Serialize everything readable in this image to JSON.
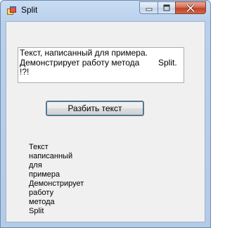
{
  "window": {
    "title": "Split"
  },
  "input": {
    "lines": [
      "Текст, написанный для примера.",
      "Демонстрирует работу метода        Split.",
      "!?!"
    ]
  },
  "split_button": {
    "label": "Разбить текст"
  },
  "result": {
    "words": [
      "Текст",
      "написанный",
      "для",
      "примера",
      "Демонстрирует",
      "работу",
      "метода",
      "Split"
    ]
  },
  "colors": {
    "titlebar": "#b9d0ec",
    "client_background": "#f0f0f0",
    "close_button": "#c0422a"
  }
}
